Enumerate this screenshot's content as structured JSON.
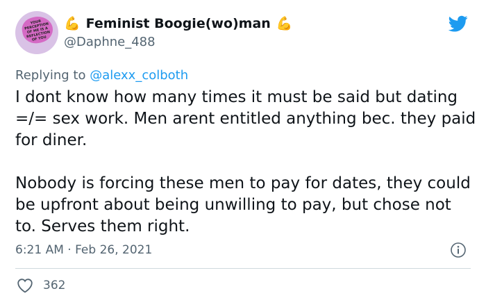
{
  "author": {
    "display_name": "Feminist Boogie(wo)man",
    "handle": "@Daphne_488",
    "avatar_text": "YOUR PERCEPTION OF ME IS A REFLECTION OF YOU",
    "emoji": "flexed-biceps-icon",
    "emoji_glyph": "💪"
  },
  "reply": {
    "prefix": "Replying to",
    "target": "@alexx_colboth"
  },
  "tweet": {
    "paragraph_1": "I dont know how many times it must be said but dating =/= sex work. Men arent entitled anything bec. they paid for diner.",
    "paragraph_2": "Nobody is forcing these men to pay for dates, they could be upfront about being unwilling to pay,  but chose not to. Serves them right.",
    "timestamp": "6:21 AM · Feb 26, 2021",
    "likes": "362"
  },
  "colors": {
    "twitter_blue": "#1d9bf0",
    "secondary_text": "#536471",
    "primary_text": "#0f1419",
    "divider": "#cfd9de"
  }
}
